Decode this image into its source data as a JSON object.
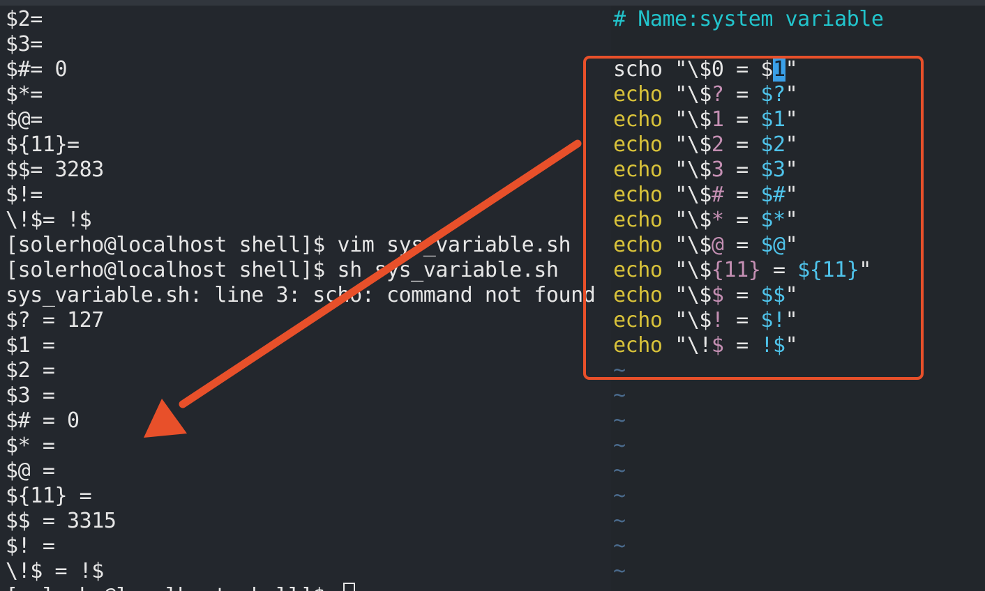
{
  "terminal": {
    "lines": [
      "$2=",
      "$3=",
      "$#= 0",
      "$*=",
      "$@=",
      "${11}=",
      "$$= 3283",
      "$!=",
      "\\!$= !$",
      "[solerho@localhost shell]$ vim sys_variable.sh",
      "[solerho@localhost shell]$ sh sys_variable.sh",
      "sys_variable.sh: line 3: scho: command not found",
      "$? = 127",
      "$1 =",
      "$2 =",
      "$3 =",
      "$# = 0",
      "$* =",
      "$@ =",
      "${11} =",
      "$$ = 3315",
      "$! =",
      "\\!$ = !$",
      "[solerho@localhost shell]$ "
    ]
  },
  "editor": {
    "comment": "# Name:system variable",
    "code_lines": [
      {
        "cmd": "scho",
        "pre": " \"\\$0 = $",
        "cursor": "1",
        "post": "\""
      },
      {
        "cmd": "echo",
        "esc": "\\$?",
        "var": "$?"
      },
      {
        "cmd": "echo",
        "esc": "\\$1",
        "var": "$1"
      },
      {
        "cmd": "echo",
        "esc": "\\$2",
        "var": "$2"
      },
      {
        "cmd": "echo",
        "esc": "\\$3",
        "var": "$3"
      },
      {
        "cmd": "echo",
        "esc": "\\$#",
        "var": "$#"
      },
      {
        "cmd": "echo",
        "esc": "\\$*",
        "var": "$*"
      },
      {
        "cmd": "echo",
        "esc": "\\$@",
        "var": "$@"
      },
      {
        "cmd": "echo",
        "esc": "\\${11}",
        "var": "${11}"
      },
      {
        "cmd": "echo",
        "esc": "\\$$",
        "var": "$$"
      },
      {
        "cmd": "echo",
        "esc": "\\$!",
        "var": "$!"
      },
      {
        "cmd": "echo",
        "esc": "\\!$",
        "var": "!$"
      }
    ],
    "tilde": "~",
    "tilde_count": 9
  },
  "annotations": {
    "box_color": "#e8502a",
    "arrow_color": "#e8502a"
  }
}
